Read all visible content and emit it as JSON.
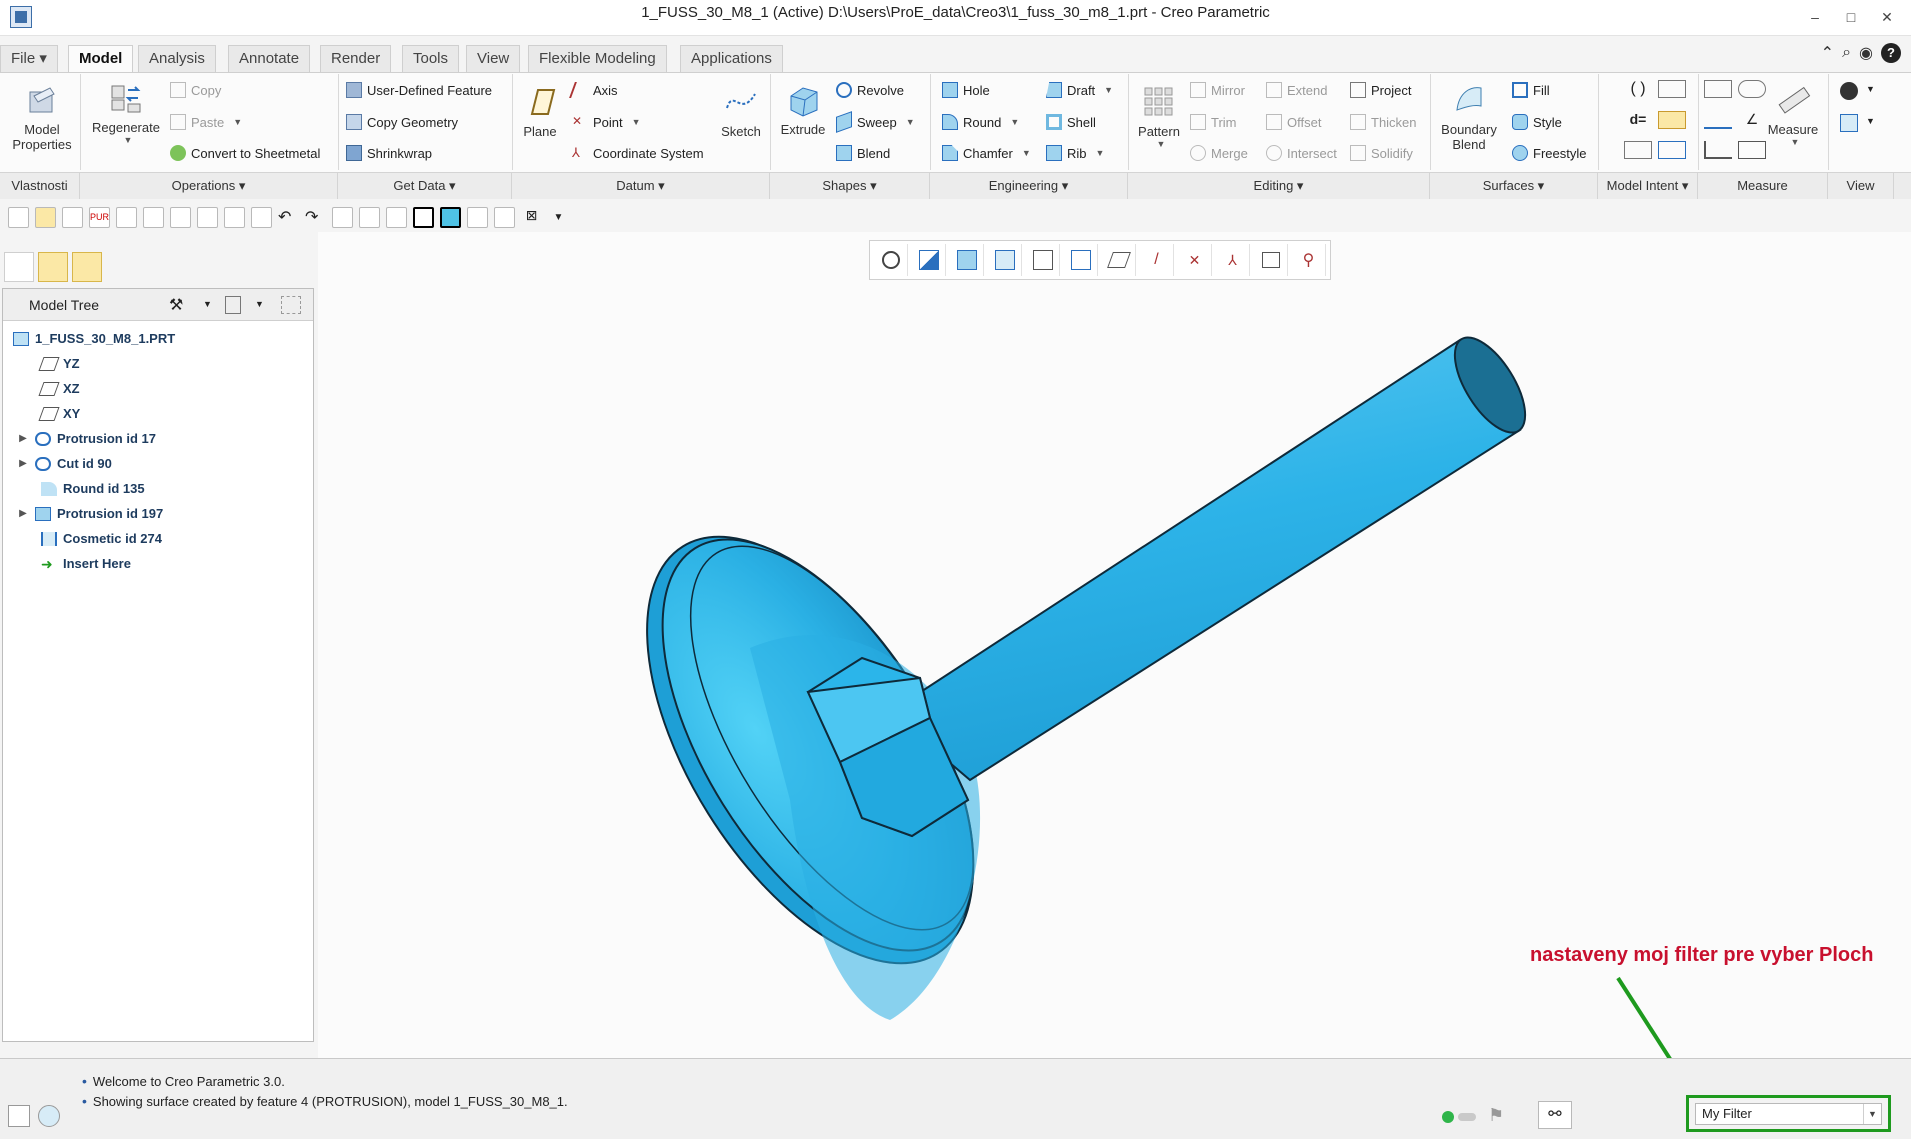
{
  "window": {
    "title": "1_FUSS_30_M8_1 (Active) D:\\Users\\ProE_data\\Creo3\\1_fuss_30_m8_1.prt - Creo Parametric",
    "minimize": "–",
    "maximize": "□",
    "close": "✕"
  },
  "tabs": [
    "File ▾",
    "Model",
    "Analysis",
    "Annotate",
    "Render",
    "Tools",
    "View",
    "Flexible Modeling",
    "Applications"
  ],
  "ribbon": {
    "model_properties": "Model Properties",
    "regenerate": "Regenerate",
    "copy": "Copy",
    "paste": "Paste",
    "convert_sheetmetal": "Convert to Sheetmetal",
    "user_defined_feature": "User-Defined Feature",
    "copy_geometry": "Copy Geometry",
    "shrinkwrap": "Shrinkwrap",
    "plane": "Plane",
    "axis": "Axis",
    "point": "Point",
    "coordinate_system": "Coordinate System",
    "sketch": "Sketch",
    "extrude": "Extrude",
    "revolve": "Revolve",
    "sweep": "Sweep",
    "blend": "Blend",
    "hole": "Hole",
    "round": "Round",
    "chamfer": "Chamfer",
    "draft": "Draft",
    "shell": "Shell",
    "rib": "Rib",
    "pattern": "Pattern",
    "mirror": "Mirror",
    "trim": "Trim",
    "merge": "Merge",
    "extend": "Extend",
    "offset": "Offset",
    "intersect": "Intersect",
    "project": "Project",
    "thicken": "Thicken",
    "solidify": "Solidify",
    "boundary_blend": "Boundary Blend",
    "fill": "Fill",
    "style": "Style",
    "freestyle": "Freestyle",
    "measure": "Measure"
  },
  "groups": [
    "Vlastnosti",
    "Operations ▾",
    "Get Data ▾",
    "Datum ▾",
    "Shapes ▾",
    "Engineering ▾",
    "Editing ▾",
    "Surfaces ▾",
    "Model Intent ▾",
    "Measure",
    "View"
  ],
  "model_tree": {
    "title": "Model Tree",
    "items": [
      {
        "label": "1_FUSS_30_M8_1.PRT"
      },
      {
        "label": "YZ"
      },
      {
        "label": "XZ"
      },
      {
        "label": "XY"
      },
      {
        "label": "Protrusion id 17"
      },
      {
        "label": "Cut id 90"
      },
      {
        "label": "Round id 135"
      },
      {
        "label": "Protrusion id 197"
      },
      {
        "label": "Cosmetic id 274"
      },
      {
        "label": "Insert Here"
      }
    ]
  },
  "annotation": "nastaveny moj filter pre vyber Ploch",
  "status": {
    "messages": [
      "Welcome to Creo Parametric 3.0.",
      "Showing surface created by feature 4 (PROTRUSION), model 1_FUSS_30_M8_1."
    ],
    "filter_value": "My Filter"
  },
  "colors": {
    "model": "#2fb4e6",
    "model_edge": "#0e2a3a",
    "annotation": "#c8102e",
    "highlight": "#1e9a1e"
  }
}
